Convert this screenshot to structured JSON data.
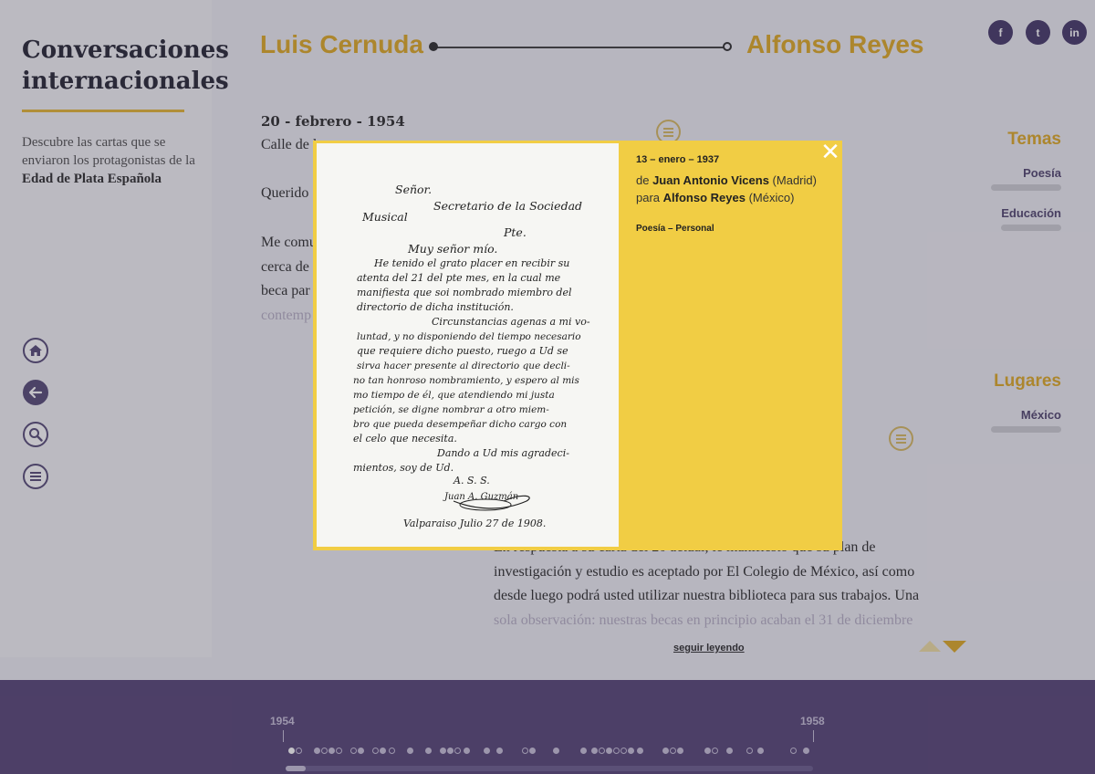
{
  "sidebar": {
    "title_line1": "Conversaciones",
    "title_line2": "internacionales",
    "desc_pre": "Descubre las cartas que se enviaron los protagonistas de la ",
    "desc_bold": "Edad de Plata Española",
    "nav": [
      "home-icon",
      "back-arrow-icon",
      "search-icon",
      "menu-icon"
    ]
  },
  "header": {
    "from": "Luis Cernuda",
    "to": "Alfonso Reyes",
    "social": [
      {
        "icon": "facebook-icon",
        "glyph": "f"
      },
      {
        "icon": "twitter-icon",
        "glyph": "t"
      },
      {
        "icon": "linkedin-icon",
        "glyph": "in"
      }
    ]
  },
  "letter": {
    "date": "20 - febrero - 1954",
    "line1": "Calle de l",
    "salutation": "Querido",
    "body1": "Me comu",
    "body2": "cerca de",
    "body3": "beca par",
    "body4": "contemp",
    "reply1": "En respuesta a su carta del 20 actual, le manifiesto que su plan de",
    "reply2": "investigación y estudio es aceptado por El Colegio de México, así como",
    "reply3": "desde luego podrá usted utilizar nuestra biblioteca para sus trabajos. Una",
    "reply4": "sola observación: nuestras becas en principio acaban el 31 de diciembre",
    "read_more": "seguir leyendo"
  },
  "panels": {
    "temas_heading": "Temas",
    "temas": [
      "Poesía",
      "Educación"
    ],
    "lugares_heading": "Lugares",
    "lugares": [
      "México"
    ]
  },
  "timeline": {
    "start_year": "1954",
    "end_year": "1958"
  },
  "modal": {
    "close": "✕",
    "date": "13 – enero – 1937",
    "from_prefix": "de ",
    "from_name": "Juan Antonio Vicens",
    "from_place": " (Madrid)",
    "to_prefix": "para ",
    "to_name": "Alfonso Reyes",
    "to_place": " (México)",
    "tags": "Poesía – Personal",
    "scan": {
      "l1": "Señor.",
      "l2": "Secretario de la Sociedad",
      "l3": "Musical",
      "l4": "Pte.",
      "l5": "Muy señor mío.",
      "l6": "He tenido el grato placer en recibir su",
      "l7": "atenta del 21 del pte mes, en la cual me",
      "l8": "manifiesta que soi nombrado miembro del",
      "l9": "directorio de dicha institución.",
      "l10": "Circunstancias agenas a mi vo-",
      "l11": "luntad, y no disponiendo del tiempo necesario",
      "l12": "que requiere dicho puesto, ruego a Ud se",
      "l13": "sirva hacer presente al directorio que decli-",
      "l14": "no tan honroso nombramiento, y espero al mis",
      "l15": "mo tiempo de él, que atendiendo mi justa",
      "l16": "petición, se digne nombrar a otro miem-",
      "l17": "bro que pueda desempeñar dicho cargo con",
      "l18": "el celo que necesita.",
      "l19": "Dando a Ud mis agradeci-",
      "l20": "mientos, soy de Ud.",
      "l21": "A. S. S.",
      "l22": "Juan A. Guzmán",
      "l23": "Valparaiso Julio 27 de 1908."
    }
  }
}
